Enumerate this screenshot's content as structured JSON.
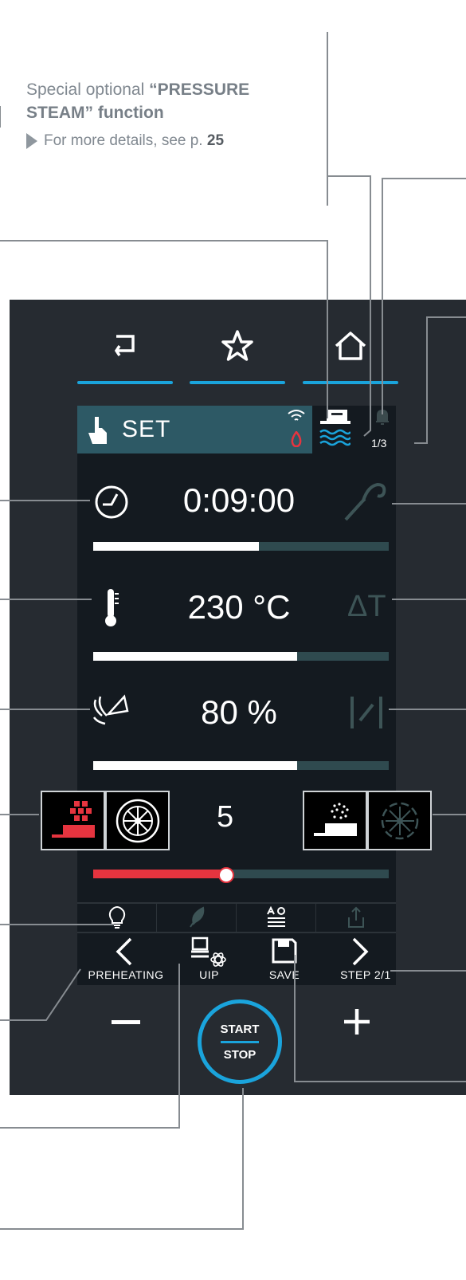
{
  "note": {
    "line1_prefix": "Special optional",
    "line1_bold": "“PRESSURE",
    "line2_bold": "STEAM” function",
    "more_text": "For more details, see p.",
    "more_page": "25"
  },
  "nav": {
    "back_icon": "back-arrow-icon",
    "fav_icon": "star-icon",
    "home_icon": "home-icon"
  },
  "set": {
    "label": "SET",
    "status_icons": [
      "wifi-icon",
      "flame-icon"
    ],
    "side_icons": [
      "tray-icon",
      "water-icon",
      "bell-icon"
    ],
    "counter": "1/3"
  },
  "rows": {
    "time": {
      "icon": "timer-icon",
      "value": "0:09:00",
      "right_icon": "probe-icon",
      "fill": 0.56
    },
    "temp": {
      "icon": "thermometer-icon",
      "value": "230 °C",
      "right_label": "ΔT",
      "fill": 0.69
    },
    "humidity": {
      "icon": "steam-humidity-icon",
      "value": "80 %",
      "right_icon": "vent-damper-icon",
      "fill": 0.69
    }
  },
  "fan": {
    "value": "5",
    "level": 0.45,
    "accent": "#e6343f",
    "left_icons": [
      "dry-heat-icon",
      "fan-icon"
    ],
    "right_icons": [
      "steam-tray-icon",
      "fan-reverse-icon"
    ]
  },
  "tools": {
    "icons": [
      "idea-bulb-icon",
      "feather-icon",
      "alarm-settings-icon",
      "upload-icon"
    ]
  },
  "bottom": {
    "preheating": "PREHEATING",
    "uip": "UIP",
    "save": "SAVE",
    "step": "STEP 2/1",
    "minus": "−",
    "plus": "+",
    "start": "START",
    "stop": "STOP"
  },
  "colors": {
    "panel": "#262b31",
    "screen": "#141a20",
    "accent_blue": "#1aa4dc",
    "bar_track": "#2f4a4f"
  }
}
